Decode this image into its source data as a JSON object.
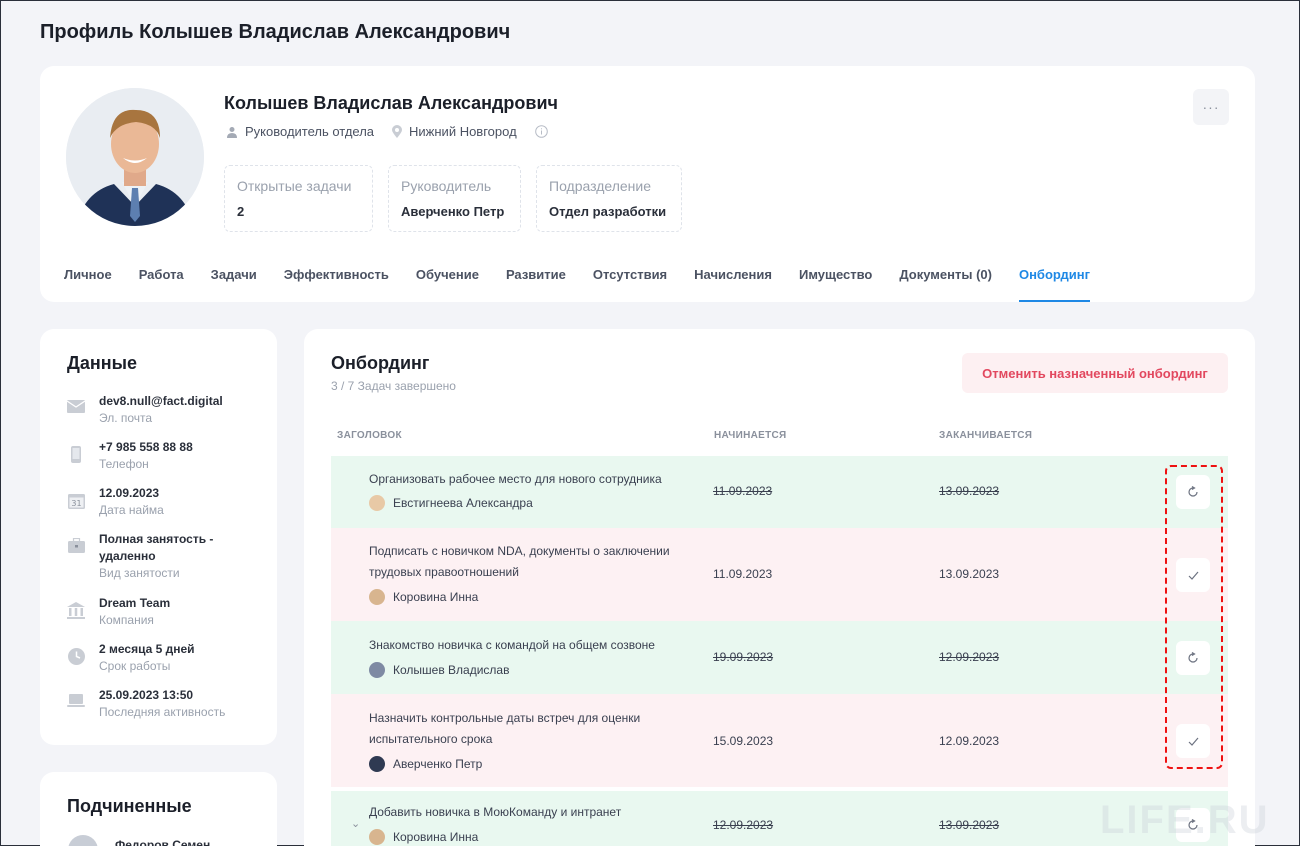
{
  "page": {
    "title": "Профиль Колышев Владислав Александрович"
  },
  "profile": {
    "name": "Колышев Владислав Александрович",
    "position": "Руководитель отдела",
    "city": "Нижний Новгород",
    "more_label": "···",
    "info": [
      {
        "label": "Открытые задачи",
        "value": "2"
      },
      {
        "label": "Руководитель",
        "value": "Аверченко Петр"
      },
      {
        "label": "Подразделение",
        "value": "Отдел разработки"
      }
    ]
  },
  "tabs": [
    {
      "label": "Личное"
    },
    {
      "label": "Работа"
    },
    {
      "label": "Задачи"
    },
    {
      "label": "Эффективность"
    },
    {
      "label": "Обучение"
    },
    {
      "label": "Развитие"
    },
    {
      "label": "Отсутствия"
    },
    {
      "label": "Начисления"
    },
    {
      "label": "Имущество"
    },
    {
      "label": "Документы (0)"
    },
    {
      "label": "Онбординг",
      "active": true
    }
  ],
  "data_card": {
    "title": "Данные",
    "rows": [
      {
        "icon": "mail-icon",
        "value": "dev8.null@fact.digital",
        "label": "Эл. почта"
      },
      {
        "icon": "phone-icon",
        "value": "+7 985 558 88 88",
        "label": "Телефон"
      },
      {
        "icon": "calendar-icon",
        "value": "12.09.2023",
        "label": "Дата найма"
      },
      {
        "icon": "briefcase-icon",
        "value": "Полная занятость - удаленно",
        "label": "Вид занятости"
      },
      {
        "icon": "bank-icon",
        "value": "Dream Team",
        "label": "Компания"
      },
      {
        "icon": "clock-icon",
        "value": "2 месяца 5 дней",
        "label": "Срок работы"
      },
      {
        "icon": "laptop-icon",
        "value": "25.09.2023 13:50",
        "label": "Последняя активность"
      }
    ]
  },
  "subordinates": {
    "title": "Подчиненные",
    "first_name": "Федоров Семен"
  },
  "onboarding": {
    "title": "Онбординг",
    "progress": "3 / 7 Задач завершено",
    "cancel_label": "Отменить назначенный онбординг",
    "headers": {
      "title": "ЗАГОЛОВОК",
      "start": "НАЧИНАЕТСЯ",
      "end": "ЗАКАНЧИВАЕТСЯ"
    },
    "tasks": [
      {
        "title": "Организовать рабочее место для нового сотрудника",
        "assignee": "Евстигнеева Александра",
        "start": "11.09.2023",
        "end": "13.09.2023",
        "status": "done",
        "action_icon": "undo-icon"
      },
      {
        "title": "Подписать с новичком NDA, документы о заключении трудовых правоотношений",
        "assignee": "Коровина Инна",
        "start": "11.09.2023",
        "end": "13.09.2023",
        "status": "pending",
        "action_icon": "check-icon"
      },
      {
        "title": "Знакомство новичка с командой на общем созвоне",
        "assignee": "Колышев Владислав",
        "start": "19.09.2023",
        "end": "12.09.2023",
        "status": "done",
        "action_icon": "undo-icon"
      },
      {
        "title": "Назначить контрольные даты встреч для оценки испытательного срока",
        "assignee": "Аверченко Петр",
        "start": "15.09.2023",
        "end": "12.09.2023",
        "status": "pending",
        "action_icon": "check-icon"
      },
      {
        "title": "Добавить новичка в МоюКоманду и интранет",
        "assignee": "Коровина Инна",
        "start": "12.09.2023",
        "end": "13.09.2023",
        "status": "done",
        "action_icon": "undo-icon"
      }
    ]
  },
  "watermark": "LIFE.RU",
  "colors": {
    "accent": "#1e88e5",
    "danger": "#e2485f",
    "done_row": "#e9f8f0",
    "pending_row": "#fdf1f3"
  }
}
